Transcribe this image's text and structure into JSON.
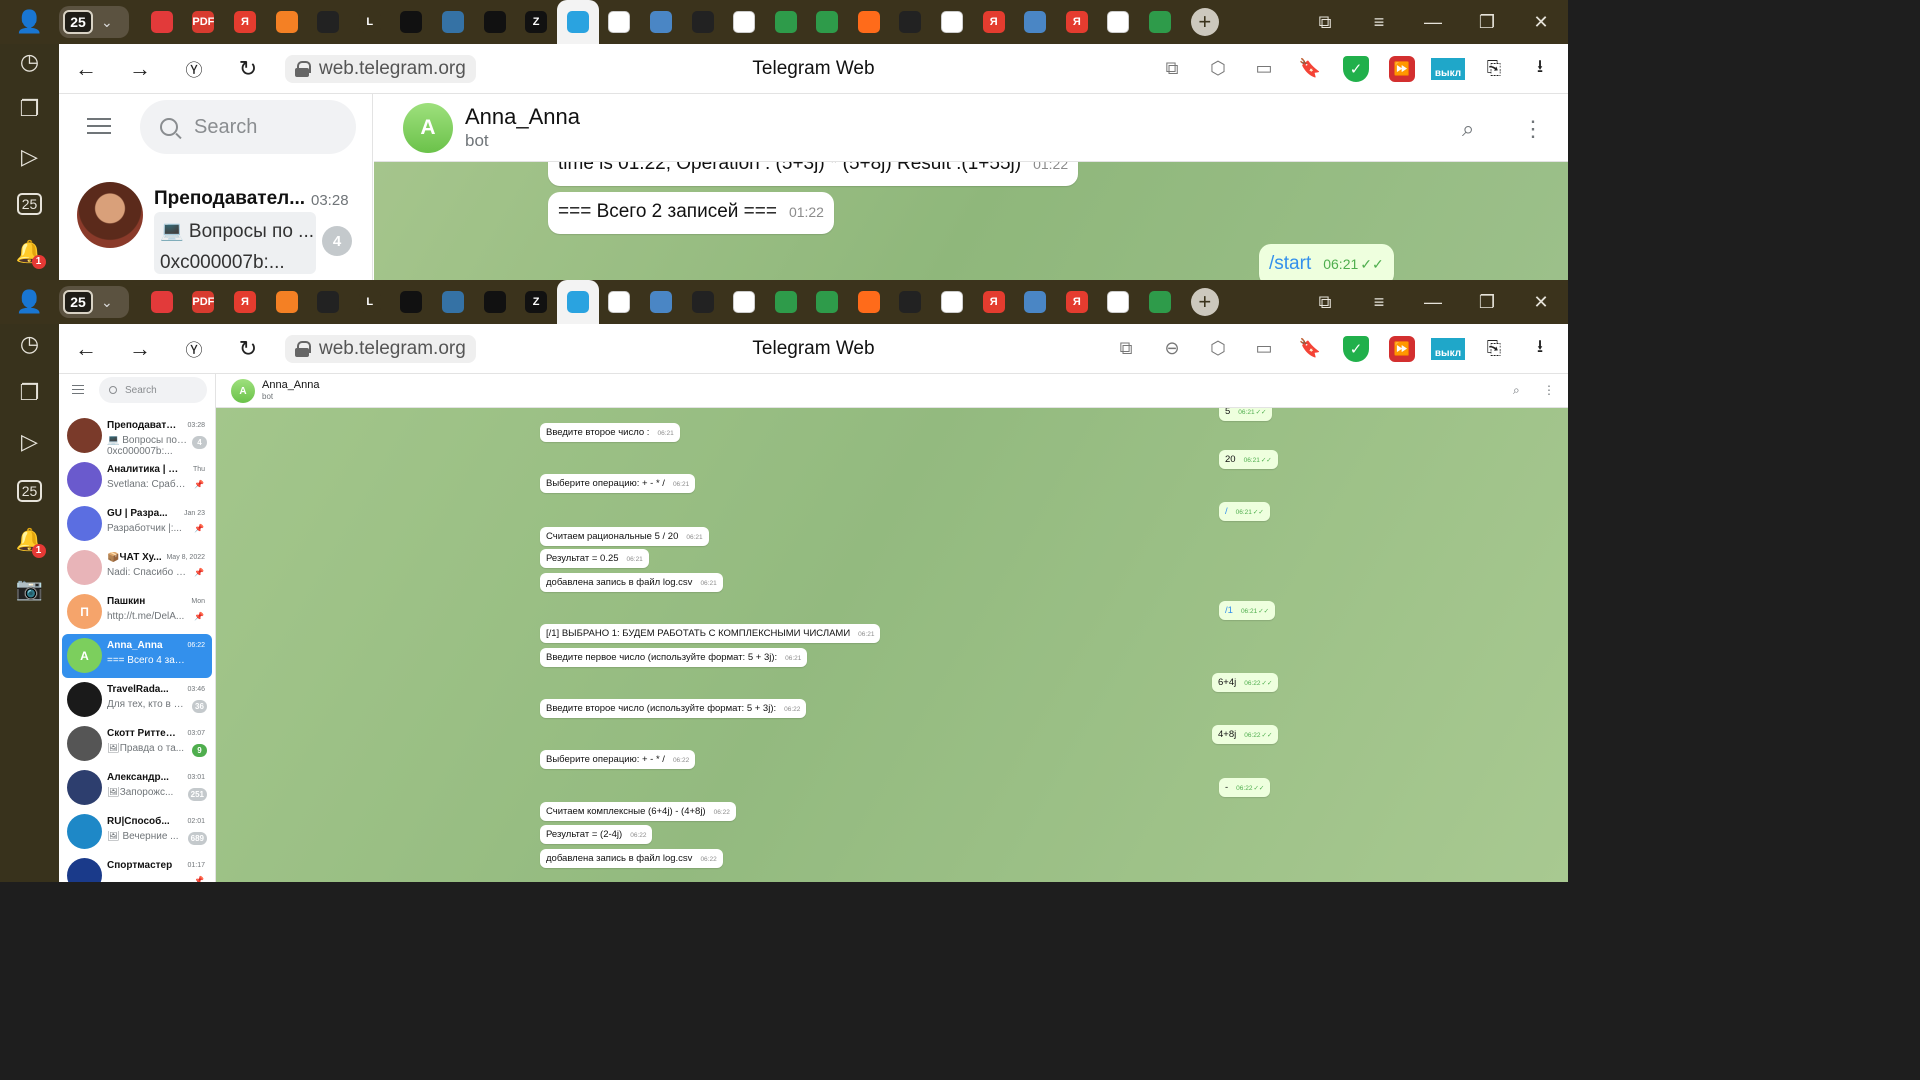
{
  "tabbar": {
    "tab_counter": "25",
    "tabs": [
      {
        "icon": "antivirus-icon",
        "color": "#e23a3a",
        "label": ""
      },
      {
        "icon": "pdf-icon",
        "color": "#d83b2f",
        "label": "PDF"
      },
      {
        "icon": "yandex-icon",
        "color": "#e43c2f",
        "label": "Я"
      },
      {
        "icon": "stackoverflow-icon",
        "color": "#f48024",
        "label": ""
      },
      {
        "icon": "github-icon",
        "color": "#222222",
        "label": ""
      },
      {
        "icon": "letter-l-icon",
        "color": "#3b331c",
        "label": "L"
      },
      {
        "icon": "coursera-icon",
        "color": "#111111",
        "label": ""
      },
      {
        "icon": "python-icon",
        "color": "#3572A5",
        "label": ""
      },
      {
        "icon": "coursera-icon",
        "color": "#111111",
        "label": ""
      },
      {
        "icon": "zen-icon",
        "color": "#111111",
        "label": "Z"
      },
      {
        "icon": "telegram-icon",
        "color": "#2aa3e0",
        "label": ""
      },
      {
        "icon": "cube-icon",
        "color": "#ffffff",
        "label": ""
      },
      {
        "icon": "doc-icon",
        "color": "#4a86c5",
        "label": ""
      },
      {
        "icon": "openai-icon",
        "color": "#222222",
        "label": ""
      },
      {
        "icon": "file-icon",
        "color": "#ffffff",
        "label": ""
      },
      {
        "icon": "green-a-icon",
        "color": "#2e9b4a",
        "label": ""
      },
      {
        "icon": "green-ring-icon",
        "color": "#2e9b4a",
        "label": ""
      },
      {
        "icon": "orange-arc-icon",
        "color": "#ff6b1a",
        "label": ""
      },
      {
        "icon": "openai-icon",
        "color": "#222222",
        "label": ""
      },
      {
        "icon": "stats-icon",
        "color": "#ffffff",
        "label": ""
      },
      {
        "icon": "yandex-icon",
        "color": "#e43c2f",
        "label": "Я"
      },
      {
        "icon": "doc-icon",
        "color": "#4a86c5",
        "label": ""
      },
      {
        "icon": "yandex-icon",
        "color": "#e43c2f",
        "label": "Я"
      },
      {
        "icon": "chart-icon",
        "color": "#ffffff",
        "label": ""
      },
      {
        "icon": "green-pill-icon",
        "color": "#2e9b4a",
        "label": ""
      }
    ]
  },
  "sidebar_rail": {
    "notifications_badge": "1"
  },
  "address": {
    "url": "web.telegram.org",
    "title": "Telegram Web",
    "vykl_label": "выкл"
  },
  "top_window": {
    "search_placeholder": "Search",
    "chat": {
      "name": "Преподавател...",
      "time": "03:28",
      "preview_line1": "💻 Вопросы по ...",
      "preview_line2": "0xc000007b:...",
      "unread": "4"
    },
    "header": {
      "avatar_letter": "A",
      "name": "Anna_Anna",
      "status": "bot"
    },
    "messages": [
      {
        "text": "time is 01:22; Operation : (5+3j) * (5+8j) Result :(1+55j)",
        "time": "01:22",
        "out": false
      },
      {
        "text": "=== Всего 2 записей ===",
        "time": "01:22",
        "out": false
      },
      {
        "text": "/start",
        "time": "06:21",
        "out": true
      }
    ]
  },
  "bottom_window": {
    "search_placeholder": "Search",
    "header": {
      "avatar_letter": "A",
      "name": "Anna_Anna",
      "status": "bot"
    },
    "chats": [
      {
        "name": "Преподавател...",
        "time": "03:28",
        "preview": "💻 Вопросы по ...",
        "preview2": "0xc000007b:...",
        "badge": "4",
        "avatar_color": "#7a3a2a",
        "avatar_letter": ""
      },
      {
        "name": "Аналитика | 9 | ...",
        "time": "Thu",
        "preview": "Svetlana: Сработ...",
        "badge": "",
        "avatar_color": "#6a5acd",
        "avatar_letter": ""
      },
      {
        "name": "GU | Разра...",
        "time": "Jan 23",
        "preview": "Разработчик |:...",
        "badge": "",
        "avatar_color": "#5b6ee1",
        "avatar_letter": ""
      },
      {
        "name": "📦ЧАТ Ху...",
        "time": "May 8, 2022",
        "preview": "Nadi: Спасибо б...",
        "badge": "",
        "avatar_color": "#e8b4b8",
        "avatar_letter": ""
      },
      {
        "name": "Пашкин",
        "time": "Mon",
        "preview": "http://t.me/DelA...",
        "badge": "",
        "avatar_color": "#f5a46b",
        "avatar_letter": "П"
      },
      {
        "name": "Anna_Anna",
        "time": "06:22",
        "preview": "=== Всего 4 записе...",
        "badge": "",
        "avatar_color": "#7ccf5d",
        "avatar_letter": "A",
        "selected": true
      },
      {
        "name": "TravelRada...",
        "time": "03:46",
        "preview": "Для тех, кто в р...",
        "badge": "36",
        "avatar_color": "#1a1a1a",
        "avatar_letter": ""
      },
      {
        "name": "Скотт Риттер ...",
        "time": "03:07",
        "preview": "🖼Правда о та...",
        "badge": "9",
        "badge_green": true,
        "avatar_color": "#555555",
        "avatar_letter": ""
      },
      {
        "name": "Александр...",
        "time": "03:01",
        "preview": "🖼Запорожс...",
        "badge": "251",
        "avatar_color": "#2d3e6e",
        "avatar_letter": ""
      },
      {
        "name": "RU|Способ...",
        "time": "02:01",
        "preview": "🖼 Вечерние ...",
        "badge": "689",
        "avatar_color": "#1e88c7",
        "avatar_letter": ""
      },
      {
        "name": "Спортмастер",
        "time": "01:17",
        "preview": "",
        "badge": "",
        "avatar_color": "#1a3a8a",
        "avatar_letter": ""
      }
    ],
    "messages": [
      {
        "text": "5",
        "time": "06:21",
        "out": true
      },
      {
        "text": "Введите второе число :",
        "time": "06:21",
        "out": false
      },
      {
        "text": "20",
        "time": "06:21",
        "out": true
      },
      {
        "text": "Выберите операцию: + - * /",
        "time": "06:21",
        "out": false
      },
      {
        "text": "/",
        "time": "06:21",
        "out": true
      },
      {
        "text": "Считаем рациональные 5 / 20",
        "time": "06:21",
        "out": false
      },
      {
        "text": "Результат = 0.25",
        "time": "06:21",
        "out": false
      },
      {
        "text": "добавлена запись в файл log.csv",
        "time": "06:21",
        "out": false
      },
      {
        "text": "/1",
        "time": "06:21",
        "out": true
      },
      {
        "text": "[/1] ВЫБРАНО 1: БУДЕМ РАБОТАТЬ С КОМПЛЕКСНЫМИ ЧИСЛАМИ",
        "time": "06:21",
        "out": false
      },
      {
        "text": "Введите первое число (используйте формат: 5 + 3j):",
        "time": "06:21",
        "out": false
      },
      {
        "text": "6+4j",
        "time": "06:22",
        "out": true
      },
      {
        "text": "Введите второе число (используйте формат: 5 + 3j):",
        "time": "06:22",
        "out": false
      },
      {
        "text": "4+8j",
        "time": "06:22",
        "out": true
      },
      {
        "text": "Выберите операцию: + - * /",
        "time": "06:22",
        "out": false
      },
      {
        "text": "-",
        "time": "06:22",
        "out": true
      },
      {
        "text": "Считаем комплексные (6+4j) - (4+8j)",
        "time": "06:22",
        "out": false
      },
      {
        "text": "Результат = (2-4j)",
        "time": "06:22",
        "out": false
      },
      {
        "text": "добавлена запись в файл log.csv",
        "time": "06:22",
        "out": false
      }
    ]
  }
}
